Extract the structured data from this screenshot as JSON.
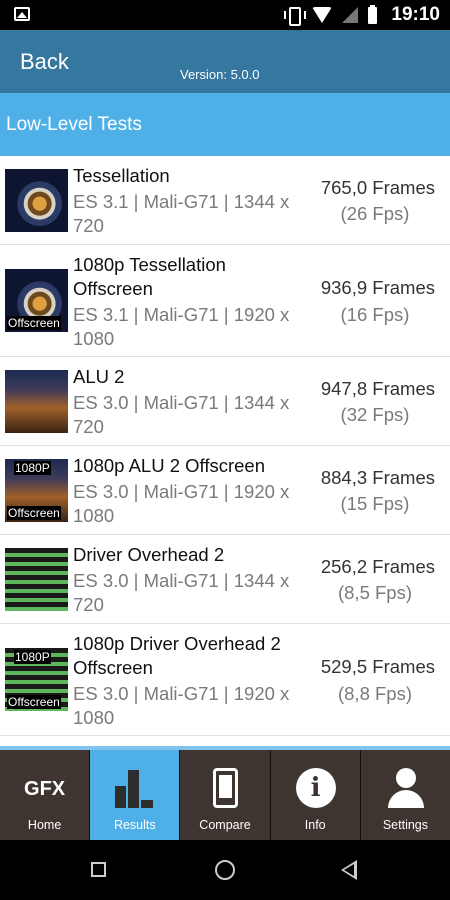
{
  "status_bar": {
    "time": "19:10"
  },
  "header": {
    "back_label": "Back",
    "version": "Version: 5.0.0"
  },
  "section": {
    "title": "Low-Level Tests"
  },
  "tests": [
    {
      "title": "Tessellation",
      "sub": "ES 3.1 | Mali-G71 | 1344 x 720",
      "frames": "765,0 Frames",
      "fps": "(26 Fps)",
      "thumb_icon": "tessellation-thumbnail"
    },
    {
      "title": "1080p Tessellation Offscreen",
      "sub": "ES 3.1 | Mali-G71 | 1920 x 1080",
      "frames": "936,9 Frames",
      "fps": "(16 Fps)",
      "thumb_icon": "tessellation-thumbnail",
      "tag_bottom": "Offscreen"
    },
    {
      "title": "ALU 2",
      "sub": "ES 3.0 | Mali-G71 | 1344 x 720",
      "frames": "947,8 Frames",
      "fps": "(32 Fps)",
      "thumb_icon": "alu-thumbnail"
    },
    {
      "title": "1080p ALU 2 Offscreen",
      "sub": "ES 3.0 | Mali-G71 | 1920 x 1080",
      "frames": "884,3 Frames",
      "fps": "(15 Fps)",
      "thumb_icon": "alu-thumbnail",
      "tag_top": "1080P",
      "tag_bottom": "Offscreen"
    },
    {
      "title": "Driver Overhead 2",
      "sub": "ES 3.0 | Mali-G71 | 1344 x 720",
      "frames": "256,2 Frames",
      "fps": "(8,5 Fps)",
      "thumb_icon": "driver-overhead-thumbnail"
    },
    {
      "title": "1080p Driver Overhead 2 Offscreen",
      "sub": "ES 3.0 | Mali-G71 | 1920 x 1080",
      "frames": "529,5 Frames",
      "fps": "(8,8 Fps)",
      "thumb_icon": "driver-overhead-thumbnail",
      "tag_top": "1080P",
      "tag_bottom": "Offscreen"
    }
  ],
  "tabs": [
    {
      "label": "Home",
      "icon": "gfx-logo",
      "logo_text": "GFX"
    },
    {
      "label": "Results",
      "icon": "bar-chart-icon",
      "active": true
    },
    {
      "label": "Compare",
      "icon": "phone-icon"
    },
    {
      "label": "Info",
      "icon": "info-icon",
      "glyph": "i"
    },
    {
      "label": "Settings",
      "icon": "user-icon"
    }
  ],
  "colors": {
    "header": "#35779f",
    "section": "#4fb0e8",
    "tab_active": "#4fb0e8",
    "tab": "#3e3530"
  }
}
